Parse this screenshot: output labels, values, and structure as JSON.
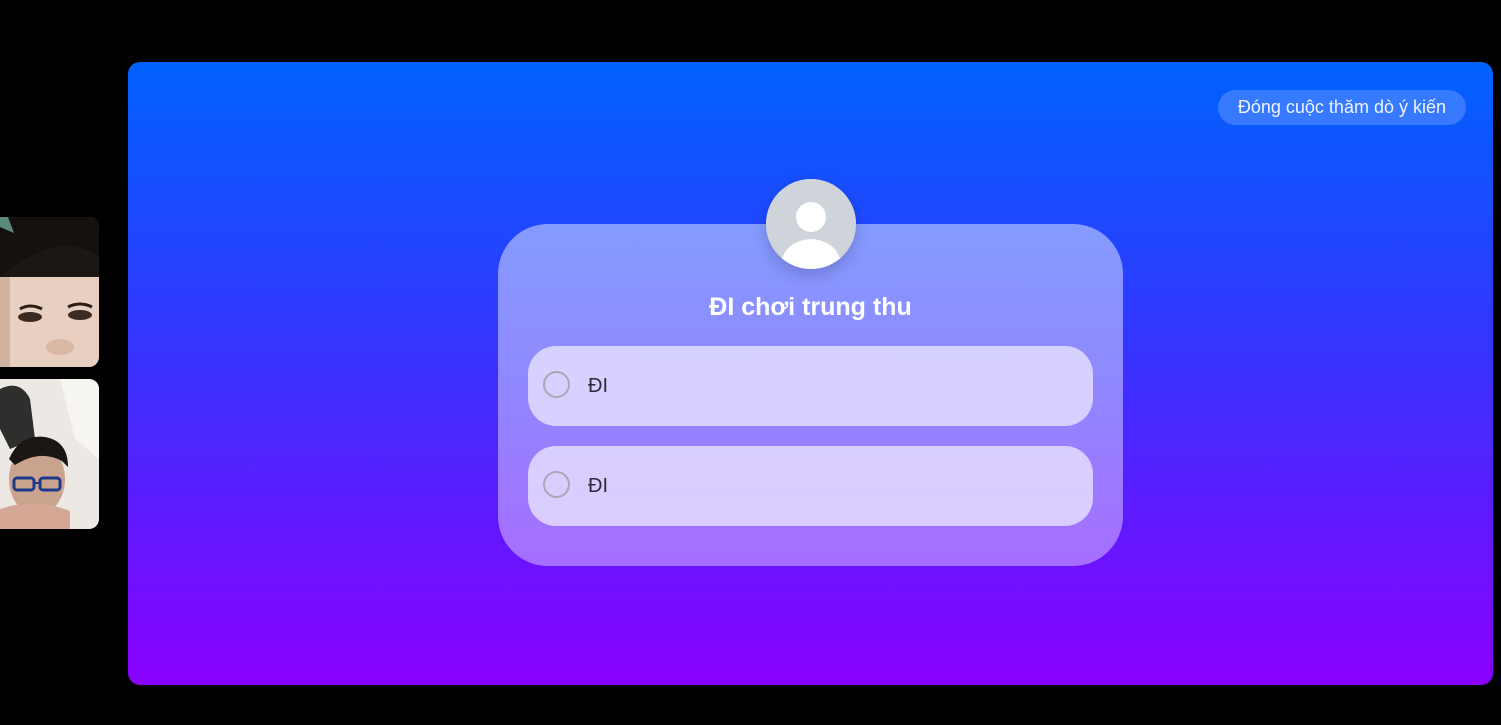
{
  "poll": {
    "close_button_label": "Đóng cuộc thăm dò ý kiến",
    "question": "ĐI chơi trung thu",
    "options": [
      {
        "label": "ĐI",
        "selected": false
      },
      {
        "label": "ĐI",
        "selected": false
      }
    ]
  },
  "participants": [
    {
      "icon": "participant-video"
    },
    {
      "icon": "participant-video"
    }
  ],
  "colors": {
    "background": "#000000",
    "stage_gradient_top": "#0062ff",
    "stage_gradient_bottom": "#8a00ff",
    "title_text": "#ffffff"
  }
}
